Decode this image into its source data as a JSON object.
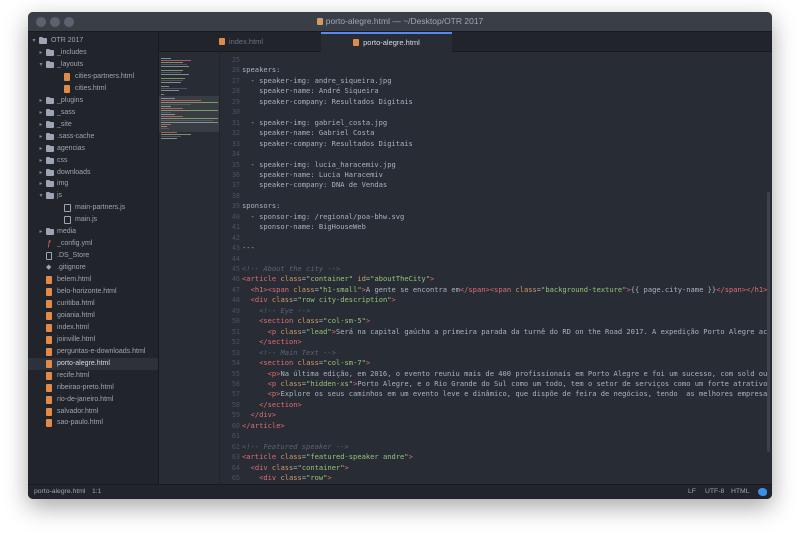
{
  "window": {
    "title": "porto-alegre.html — ~/Desktop/OTR 2017"
  },
  "colors": {
    "tag": "#e06c75",
    "attr": "#d19a66",
    "string": "#98c379",
    "comment": "#5c6370",
    "text": "#abb2bf"
  },
  "tabs": [
    {
      "label": "index.html",
      "active": false
    },
    {
      "label": "porto-alegre.html",
      "active": true
    }
  ],
  "sidebar": {
    "root": "OTR 2017",
    "items": [
      {
        "label": "_includes",
        "kind": "folder",
        "depth": 1,
        "open": false
      },
      {
        "label": "_layouts",
        "kind": "folder",
        "depth": 1,
        "open": true
      },
      {
        "label": "cities-partners.html",
        "kind": "html",
        "depth": 2
      },
      {
        "label": "cities.html",
        "kind": "html",
        "depth": 2
      },
      {
        "label": "_plugins",
        "kind": "folder",
        "depth": 1,
        "open": false
      },
      {
        "label": "_sass",
        "kind": "folder",
        "depth": 1,
        "open": false
      },
      {
        "label": "_site",
        "kind": "folder",
        "depth": 1,
        "open": false
      },
      {
        "label": ".sass-cache",
        "kind": "folder",
        "depth": 1,
        "open": false
      },
      {
        "label": "agencias",
        "kind": "folder",
        "depth": 1,
        "open": false
      },
      {
        "label": "css",
        "kind": "folder",
        "depth": 1,
        "open": false
      },
      {
        "label": "downloads",
        "kind": "folder",
        "depth": 1,
        "open": false
      },
      {
        "label": "img",
        "kind": "folder",
        "depth": 1,
        "open": false
      },
      {
        "label": "js",
        "kind": "folder",
        "depth": 1,
        "open": true
      },
      {
        "label": "main-partners.js",
        "kind": "js",
        "depth": 2
      },
      {
        "label": "main.js",
        "kind": "js",
        "depth": 2
      },
      {
        "label": "media",
        "kind": "folder",
        "depth": 1,
        "open": false
      },
      {
        "label": "_config.yml",
        "kind": "yml",
        "depth": 1
      },
      {
        "label": ".DS_Store",
        "kind": "file",
        "depth": 1
      },
      {
        "label": ".gitignore",
        "kind": "git",
        "depth": 1
      },
      {
        "label": "belem.html",
        "kind": "html",
        "depth": 1
      },
      {
        "label": "belo-horizonte.html",
        "kind": "html",
        "depth": 1
      },
      {
        "label": "curitiba.html",
        "kind": "html",
        "depth": 1
      },
      {
        "label": "goiania.html",
        "kind": "html",
        "depth": 1
      },
      {
        "label": "index.html",
        "kind": "html",
        "depth": 1
      },
      {
        "label": "joinville.html",
        "kind": "html",
        "depth": 1
      },
      {
        "label": "perguntas-e-downloads.html",
        "kind": "html",
        "depth": 1
      },
      {
        "label": "porto-alegre.html",
        "kind": "html",
        "depth": 1,
        "selected": true
      },
      {
        "label": "recife.html",
        "kind": "html",
        "depth": 1
      },
      {
        "label": "ribeirao-preto.html",
        "kind": "html",
        "depth": 1
      },
      {
        "label": "rio-de-janeiro.html",
        "kind": "html",
        "depth": 1
      },
      {
        "label": "salvador.html",
        "kind": "html",
        "depth": 1
      },
      {
        "label": "sao-paulo.html",
        "kind": "html",
        "depth": 1
      }
    ]
  },
  "editor": {
    "line_numbers": [
      "25",
      "26",
      "27",
      "28",
      "29",
      "30",
      "31",
      "32",
      "33",
      "34",
      "35",
      "36",
      "37",
      "38",
      "39",
      "40",
      "41",
      "42",
      "43",
      "44",
      "45",
      "46",
      "47",
      "48",
      "49",
      "50",
      "51",
      "52",
      "53",
      "54",
      "55",
      "56",
      "57",
      "58",
      "59",
      "60",
      "61",
      "62",
      "63",
      "64",
      "65",
      "66"
    ],
    "lines": [
      [
        [
          "t",
          ""
        ]
      ],
      [
        [
          "t",
          "speakers:"
        ]
      ],
      [
        [
          "t",
          "  - speaker-img: andre_siqueira.jpg"
        ]
      ],
      [
        [
          "t",
          "    speaker-name: André Siqueira"
        ]
      ],
      [
        [
          "t",
          "    speaker-company: Resultados Digitais"
        ]
      ],
      [
        [
          "t",
          ""
        ]
      ],
      [
        [
          "t",
          "  - speaker-img: gabriel_costa.jpg"
        ]
      ],
      [
        [
          "t",
          "    speaker-name: Gabriel Costa"
        ]
      ],
      [
        [
          "t",
          "    speaker-company: Resultados Digitais"
        ]
      ],
      [
        [
          "t",
          ""
        ]
      ],
      [
        [
          "t",
          "  - speaker-img: lucia_haracemiv.jpg"
        ]
      ],
      [
        [
          "t",
          "    speaker-name: Lucia Haracemiv"
        ]
      ],
      [
        [
          "t",
          "    speaker-company: DNA de Vendas"
        ]
      ],
      [
        [
          "t",
          ""
        ]
      ],
      [
        [
          "t",
          "sponsors:"
        ]
      ],
      [
        [
          "t",
          "  - sponsor-img: /regional/poa-bhw.svg"
        ]
      ],
      [
        [
          "t",
          "    sponsor-name: BigHouseWeb"
        ]
      ],
      [
        [
          "t",
          ""
        ]
      ],
      [
        [
          "t",
          "---"
        ]
      ],
      [
        [
          "t",
          ""
        ]
      ],
      [
        [
          "c",
          "<!-- About the city -->"
        ]
      ],
      [
        [
          "g",
          "<article "
        ],
        [
          "a",
          "class"
        ],
        [
          "t",
          "="
        ],
        [
          "s",
          "\"container\""
        ],
        [
          "t",
          " "
        ],
        [
          "a",
          "id"
        ],
        [
          "t",
          "="
        ],
        [
          "s",
          "\"aboutTheCity\""
        ],
        [
          "g",
          ">"
        ]
      ],
      [
        [
          "t",
          "  "
        ],
        [
          "g",
          "<h1>"
        ],
        [
          "g",
          "<span "
        ],
        [
          "a",
          "class"
        ],
        [
          "t",
          "="
        ],
        [
          "s",
          "\"h1-small\""
        ],
        [
          "g",
          ">"
        ],
        [
          "t",
          "A gente se encontra em"
        ],
        [
          "g",
          "</span>"
        ],
        [
          "g",
          "<span "
        ],
        [
          "a",
          "class"
        ],
        [
          "t",
          "="
        ],
        [
          "s",
          "\"background-texture\""
        ],
        [
          "g",
          ">"
        ],
        [
          "t",
          "{{ page.city-name }}"
        ],
        [
          "g",
          "</span>"
        ],
        [
          "g",
          "</h1>"
        ]
      ],
      [
        [
          "t",
          "  "
        ],
        [
          "g",
          "<div "
        ],
        [
          "a",
          "class"
        ],
        [
          "t",
          "="
        ],
        [
          "s",
          "\"row city-description\""
        ],
        [
          "g",
          ">"
        ]
      ],
      [
        [
          "t",
          "    "
        ],
        [
          "c",
          "<!-- Eye -->"
        ]
      ],
      [
        [
          "t",
          "    "
        ],
        [
          "g",
          "<section "
        ],
        [
          "a",
          "class"
        ],
        [
          "t",
          "="
        ],
        [
          "s",
          "\"col-sm-5\""
        ],
        [
          "g",
          ">"
        ]
      ],
      [
        [
          "t",
          "      "
        ],
        [
          "g",
          "<p "
        ],
        [
          "a",
          "class"
        ],
        [
          "t",
          "="
        ],
        [
          "s",
          "\"lead\""
        ],
        [
          "g",
          ">"
        ],
        [
          "t",
          "Será na capital gaúcha a primeira parada da turnê do RD on the Road 2017. A expedição Porto Alegre ac"
        ]
      ],
      [
        [
          "t",
          "    "
        ],
        [
          "g",
          "</section>"
        ]
      ],
      [
        [
          "t",
          "    "
        ],
        [
          "c",
          "<!-- Main Text -->"
        ]
      ],
      [
        [
          "t",
          "    "
        ],
        [
          "g",
          "<section "
        ],
        [
          "a",
          "class"
        ],
        [
          "t",
          "="
        ],
        [
          "s",
          "\"col-sm-7\""
        ],
        [
          "g",
          ">"
        ]
      ],
      [
        [
          "t",
          "      "
        ],
        [
          "g",
          "<p>"
        ],
        [
          "t",
          "Na última edição, em 2016, o evento reuniu mais de 400 profissionais em Porto Alegre e foi um sucesso, com sold ou"
        ]
      ],
      [
        [
          "t",
          "      "
        ],
        [
          "g",
          "<p "
        ],
        [
          "a",
          "class"
        ],
        [
          "t",
          "="
        ],
        [
          "s",
          "\"hidden-xs\""
        ],
        [
          "g",
          ">"
        ],
        [
          "t",
          "Porto Alegre, e o Rio Grande do Sul como um todo, tem o setor de serviços como um forte atrativo"
        ]
      ],
      [
        [
          "t",
          "      "
        ],
        [
          "g",
          "<p>"
        ],
        [
          "t",
          "Explore os seus caminhos em um evento leve e dinâmico, que dispõe de feira de negócios, tendo  as melhores empresa"
        ]
      ],
      [
        [
          "t",
          "    "
        ],
        [
          "g",
          "</section>"
        ]
      ],
      [
        [
          "t",
          "  "
        ],
        [
          "g",
          "</div>"
        ]
      ],
      [
        [
          "g",
          "</article>"
        ]
      ],
      [
        [
          "t",
          ""
        ]
      ],
      [
        [
          "c",
          "<!-- Featured speaker -->"
        ]
      ],
      [
        [
          "g",
          "<article "
        ],
        [
          "a",
          "class"
        ],
        [
          "t",
          "="
        ],
        [
          "s",
          "\"featured-speaker andre\""
        ],
        [
          "g",
          ">"
        ]
      ],
      [
        [
          "t",
          "  "
        ],
        [
          "g",
          "<div "
        ],
        [
          "a",
          "class"
        ],
        [
          "t",
          "="
        ],
        [
          "s",
          "\"container\""
        ],
        [
          "g",
          ">"
        ]
      ],
      [
        [
          "t",
          "    "
        ],
        [
          "g",
          "<div "
        ],
        [
          "a",
          "class"
        ],
        [
          "t",
          "="
        ],
        [
          "s",
          "\"row\""
        ],
        [
          "g",
          ">"
        ]
      ],
      [
        [
          "t",
          ""
        ]
      ]
    ]
  },
  "statusbar": {
    "file": "porto-alegre.html",
    "cursor": "1:1",
    "line_ending": "LF",
    "encoding": "UTF-8",
    "grammar": "HTML"
  }
}
